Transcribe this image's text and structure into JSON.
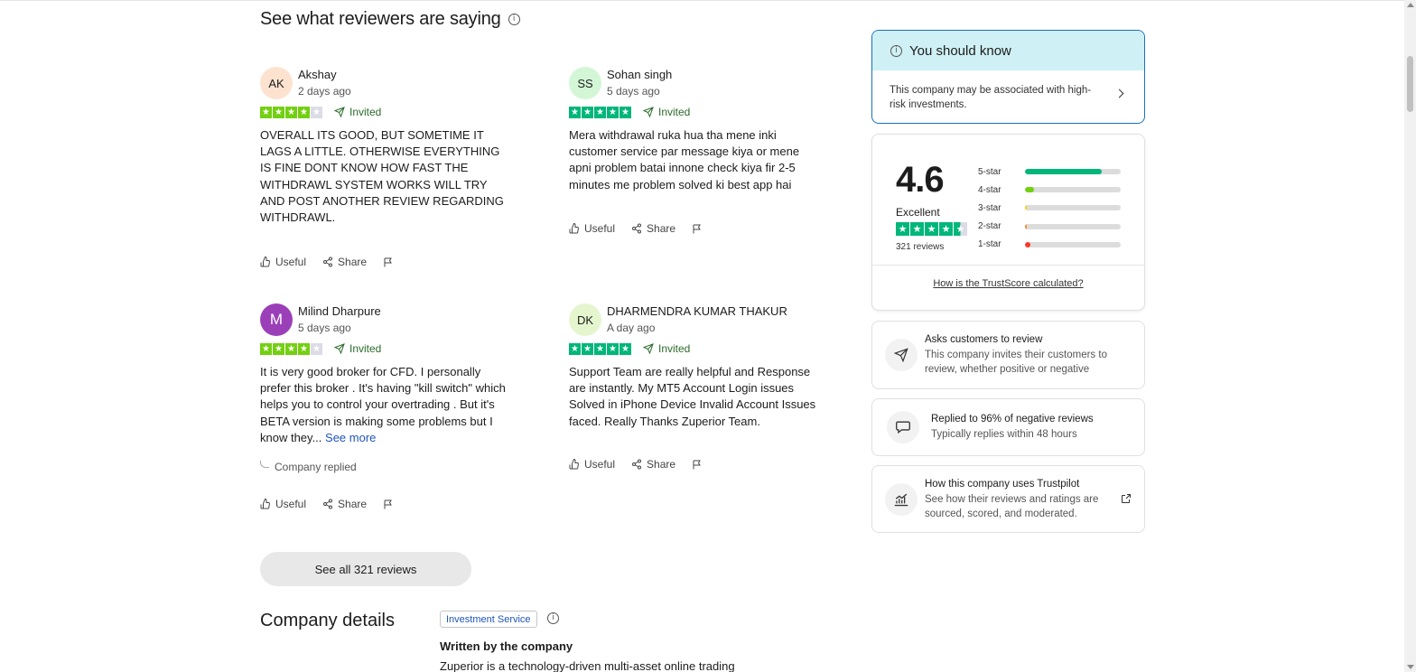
{
  "section": {
    "title": "See what reviewers are saying",
    "info_glyph": "i"
  },
  "reviews": [
    {
      "initials": "AK",
      "name": "Akshay",
      "date": "2 days ago",
      "rating": 4,
      "invited": "Invited",
      "text": "OVERALL ITS GOOD, BUT SOMETIME IT LAGS A LITTLE. OTHERWISE EVERYTHING IS FINE DONT KNOW HOW FAST THE WITHDRAWL SYSTEM WORKS WILL TRY AND POST ANOTHER REVIEW REGARDING WITHDRAWL.",
      "avatar_color": "#fde3cf"
    },
    {
      "initials": "SS",
      "name": "Sohan singh",
      "date": "5 days ago",
      "rating": 5,
      "invited": "Invited",
      "text": "Mera withdrawal ruka hua tha mene inki customer service par message kiya or mene apni problem batai innone check kiya fir 2-5 minutes me problem solved ki best app hai",
      "avatar_color": "#d3f7d6"
    },
    {
      "initials": "M",
      "name": "Milind Dharpure",
      "date": "5 days ago",
      "rating": 4,
      "invited": "Invited",
      "text": "It is very good broker for CFD. I personally prefer this broker . It's having \"kill switch\" which helps you to control your overtrading . But it's BETA version is making some problems but I know they...",
      "see_more": "See more",
      "company_replied": "Company replied",
      "avatar_color": "#9b3fb8"
    },
    {
      "initials": "DK",
      "name": "DHARMENDRA KUMAR THAKUR",
      "date": "A day ago",
      "rating": 5,
      "invited": "Invited",
      "text": "Support Team are really helpful and Response are instantly. My MT5 Account Login issues Solved in iPhone Device Invalid Account Issues faced. Really Thanks Zuperior Team.",
      "avatar_color": "#e5f6cf"
    }
  ],
  "actions": {
    "useful": "Useful",
    "share": "Share"
  },
  "see_all_button": "See all 321 reviews",
  "company": {
    "title": "Company details",
    "category": "Investment Service",
    "written_by": "Written by the company",
    "description": "Zuperior is a technology-driven multi-asset online trading"
  },
  "you_should_know": {
    "title": "You should know",
    "body": "This company may be associated with high-risk investments."
  },
  "trustscore": {
    "score": "4.6",
    "label": "Excellent",
    "stars": 4.5,
    "review_count": "321 reviews",
    "distribution": [
      {
        "label": "5-star",
        "percent": 80,
        "color": "#00b67a"
      },
      {
        "label": "4-star",
        "percent": 9,
        "color": "#73cf11"
      },
      {
        "label": "3-star",
        "percent": 2,
        "color": "#ffce00"
      },
      {
        "label": "2-star",
        "percent": 2,
        "color": "#ff8622"
      },
      {
        "label": "1-star",
        "percent": 6,
        "color": "#ff3722"
      }
    ],
    "link": "How is the TrustScore calculated?"
  },
  "info_cards": [
    {
      "icon": "paper-plane-icon",
      "title": "Asks customers to review",
      "subtitle": "This company invites their customers to review, whether positive or negative"
    },
    {
      "icon": "speech-bubble-icon",
      "title": "Replied to 96% of negative reviews",
      "subtitle": "Typically replies within 48 hours"
    },
    {
      "icon": "chart-icon",
      "title": "How this company uses Trustpilot",
      "subtitle": "See how their reviews and ratings are sourced, scored, and moderated."
    }
  ],
  "colors": {
    "star_5": "#00b67a",
    "star_4": "#73cf11",
    "star_empty": "#dcdce6",
    "accent_blue": "#1f55b8",
    "know_bg": "#cff0f4"
  }
}
